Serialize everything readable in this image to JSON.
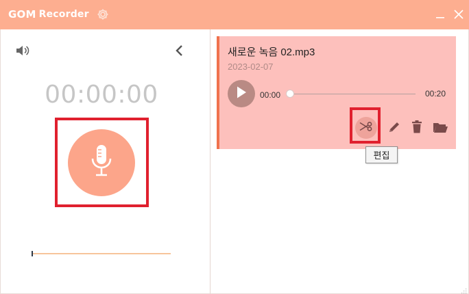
{
  "app": {
    "logo_primary": "GOM",
    "logo_secondary": "Recorder"
  },
  "icons": {
    "settings": "gear-icon",
    "minimize": "minimize-icon",
    "close": "close-icon",
    "volume": "speaker-icon",
    "collapse": "chevron-left-icon",
    "record": "microphone-icon",
    "play": "play-icon",
    "edit": "scissors-icon",
    "rename": "pencil-icon",
    "delete": "trash-icon",
    "open_folder": "folder-open-icon"
  },
  "recorder": {
    "elapsed": "00:00:00",
    "input_level": 0.0
  },
  "recordings": [
    {
      "title": "새로운 녹음 02.mp3",
      "date": "2023-02-07",
      "current_time": "00:00",
      "duration": "00:20",
      "progress": 0.0
    }
  ],
  "tooltip": {
    "text": "편집"
  },
  "colors": {
    "brand": "#fdae90",
    "record_button": "#fca58a",
    "card_background": "#fdc0bc",
    "card_accent": "#f0724d",
    "highlight": "#e0202e",
    "timer_text": "#c6c6c6"
  }
}
